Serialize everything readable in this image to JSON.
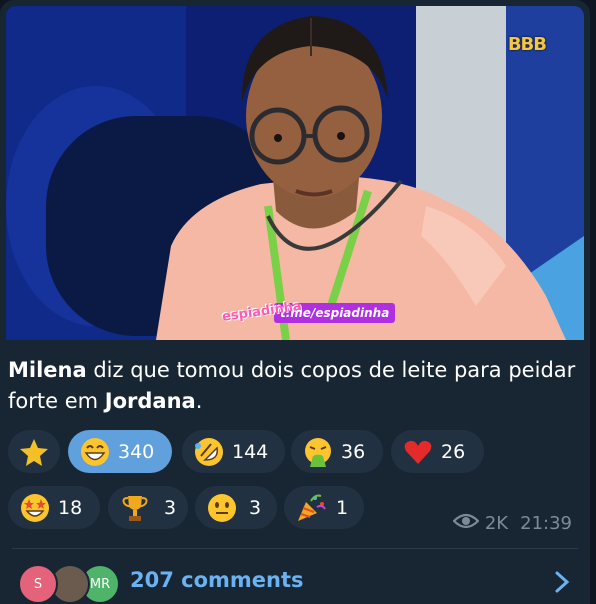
{
  "post": {
    "media": {
      "brand_logo_text": "BBB",
      "watermark_logo": "espiadinha",
      "watermark_link": "t.me/espiadinha"
    },
    "caption": {
      "part1_bold": "Milena",
      "part2": " diz que tomou dois copos de leite para peidar forte em ",
      "part3_bold": "Jordana",
      "part4": "."
    },
    "reactions": [
      {
        "emoji": "star",
        "count": ""
      },
      {
        "emoji": "grinning-face",
        "count": "340",
        "active": true
      },
      {
        "emoji": "rolling-laughing-face",
        "count": "144"
      },
      {
        "emoji": "vomiting-face",
        "count": "36"
      },
      {
        "emoji": "red-heart",
        "count": "26"
      },
      {
        "emoji": "star-struck-face",
        "count": "18"
      },
      {
        "emoji": "trophy",
        "count": "3"
      },
      {
        "emoji": "neutral-face",
        "count": "3"
      },
      {
        "emoji": "party-popper",
        "count": "1"
      }
    ],
    "views": "2K",
    "time": "21:39",
    "comments": {
      "avatars": [
        "S",
        "",
        "MR"
      ],
      "label": "207 comments"
    }
  },
  "colors": {
    "bubble": "#182533",
    "reaction_bg": "#223142",
    "reaction_active": "#5fa0dd",
    "link": "#6ab2f2",
    "meta": "#7c8b9a"
  }
}
